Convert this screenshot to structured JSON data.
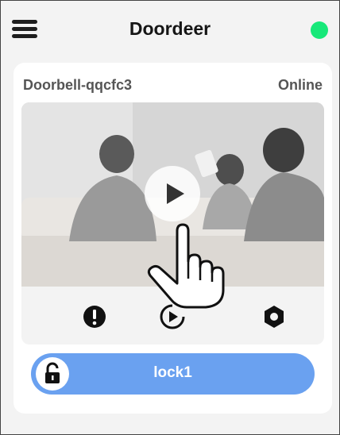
{
  "header": {
    "title": "Doordeer",
    "status_color": "#17e879"
  },
  "device": {
    "name": "Doorbell-qqcfc3",
    "status": "Online"
  },
  "controls": [
    {
      "name": "alert-icon"
    },
    {
      "name": "playback-icon"
    },
    {
      "name": "settings-icon"
    }
  ],
  "lock": {
    "label": "lock1",
    "bar_color": "#6aa1f0",
    "state": "unlocked"
  }
}
